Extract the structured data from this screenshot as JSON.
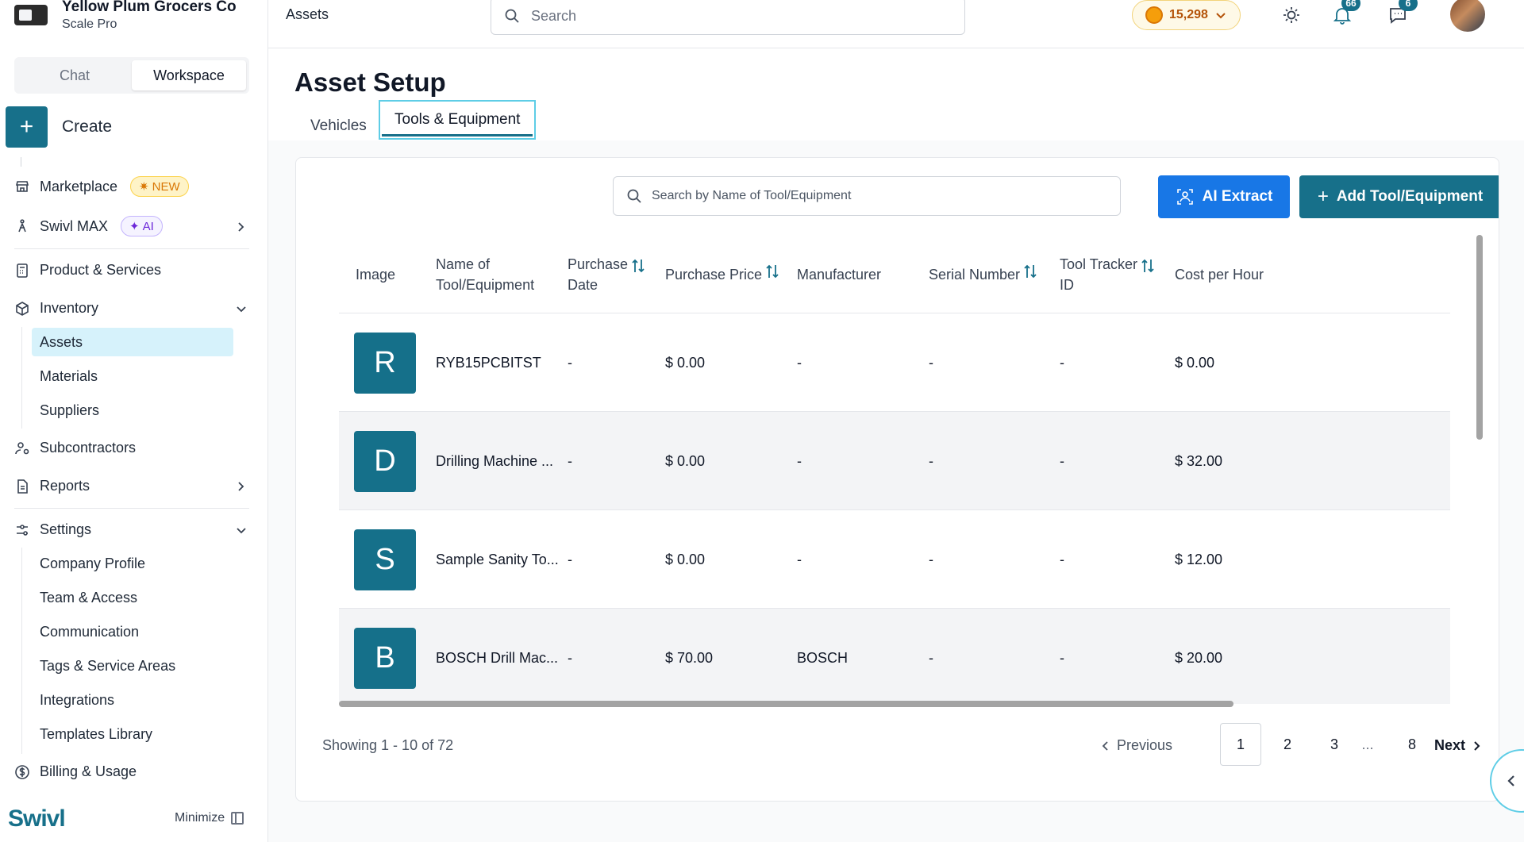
{
  "sidebar": {
    "org_name": "Yellow Plum Grocers Co",
    "org_plan": "Scale Pro",
    "mode_tabs": [
      "Chat",
      "Workspace"
    ],
    "create_label": "Create",
    "marketplace": {
      "label": "Marketplace",
      "badge": "NEW"
    },
    "swivl_max": {
      "label": "Swivl MAX",
      "badge": "AI"
    },
    "product_services": "Product & Services",
    "inventory": {
      "label": "Inventory",
      "children": [
        "Assets",
        "Materials",
        "Suppliers"
      ]
    },
    "subcontractors": "Subcontractors",
    "reports": "Reports",
    "settings": {
      "label": "Settings",
      "children": [
        "Company Profile",
        "Team & Access",
        "Communication",
        "Tags & Service Areas",
        "Integrations",
        "Templates Library"
      ]
    },
    "billing": "Billing & Usage",
    "brand": "Swivl",
    "minimize": "Minimize"
  },
  "header": {
    "title": "Assets",
    "search_placeholder": "Search",
    "credits": "15,298",
    "notifications_count": "66",
    "messages_count": "6"
  },
  "page": {
    "title": "Asset Setup",
    "tabs": [
      "Vehicles",
      "Tools & Equipment"
    ]
  },
  "toolbar": {
    "search_placeholder": "Search by Name of Tool/Equipment",
    "ai_extract": "AI Extract",
    "add_button": "Add Tool/Equipment"
  },
  "table": {
    "columns": {
      "image": "Image",
      "name_1": "Name of",
      "name_2": "Tool/Equipment",
      "pdate_1": "Purchase",
      "pdate_2": "Date",
      "price": "Purchase Price",
      "manufacturer": "Manufacturer",
      "serial": "Serial Number",
      "tracker_1": "Tool Tracker",
      "tracker_2": "ID",
      "cost": "Cost per Hour"
    },
    "rows": [
      {
        "initial": "R",
        "name": "RYB15PCBITST",
        "purchase_date": "-",
        "price": "$ 0.00",
        "manufacturer": "-",
        "serial": "-",
        "tracker": "-",
        "cost": "$ 0.00"
      },
      {
        "initial": "D",
        "name": "Drilling Machine ...",
        "purchase_date": "-",
        "price": "$ 0.00",
        "manufacturer": "-",
        "serial": "-",
        "tracker": "-",
        "cost": "$ 32.00"
      },
      {
        "initial": "S",
        "name": "Sample Sanity To...",
        "purchase_date": "-",
        "price": "$ 0.00",
        "manufacturer": "-",
        "serial": "-",
        "tracker": "-",
        "cost": "$ 12.00"
      },
      {
        "initial": "B",
        "name": "BOSCH Drill Mac...",
        "purchase_date": "-",
        "price": "$ 70.00",
        "manufacturer": "BOSCH",
        "serial": "-",
        "tracker": "-",
        "cost": "$ 20.00"
      }
    ]
  },
  "pagination": {
    "showing": "Showing 1 - 10 of 72",
    "previous": "Previous",
    "pages": [
      "1",
      "2",
      "3",
      "...",
      "8"
    ],
    "next": "Next"
  },
  "colors": {
    "primary": "#17708a",
    "ai_button": "#1877e6",
    "active_nav": "#d6f2fb"
  }
}
